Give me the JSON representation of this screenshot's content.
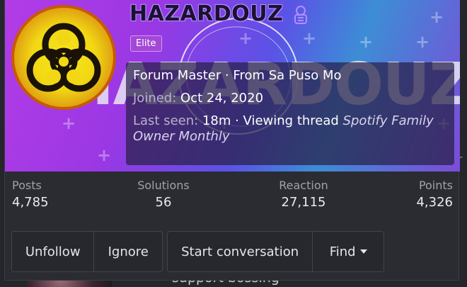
{
  "profile": {
    "username": "HAZARDOUZ",
    "banner_text": "HAZARDOUZ",
    "badge": "Elite",
    "rank_line": "Forum Master · From Sa Puso Mo",
    "joined_label": "Joined:",
    "joined_value": "Oct 24, 2020",
    "last_seen_label": "Last seen:",
    "last_seen_value": "18m · Viewing thread",
    "viewing_thread": "Spotify Family Owner Monthly",
    "avatar_icon": "biohazard-icon"
  },
  "stats": [
    {
      "label": "Posts",
      "value": "4,785"
    },
    {
      "label": "Solutions",
      "value": "56"
    },
    {
      "label": "Reaction",
      "value": "27,115"
    },
    {
      "label": "Points",
      "value": "4,326"
    }
  ],
  "actions": {
    "unfollow": "Unfollow",
    "ignore": "Ignore",
    "start_conversation": "Start conversation",
    "find": "Find"
  },
  "background": {
    "bottom_text": "support  bossing",
    "right_text": "r"
  },
  "colors": {
    "badge": "#a347d6",
    "banner_start": "#b23ce6",
    "banner_end": "#3d8dd6",
    "card_bg": "#2a2c31"
  }
}
